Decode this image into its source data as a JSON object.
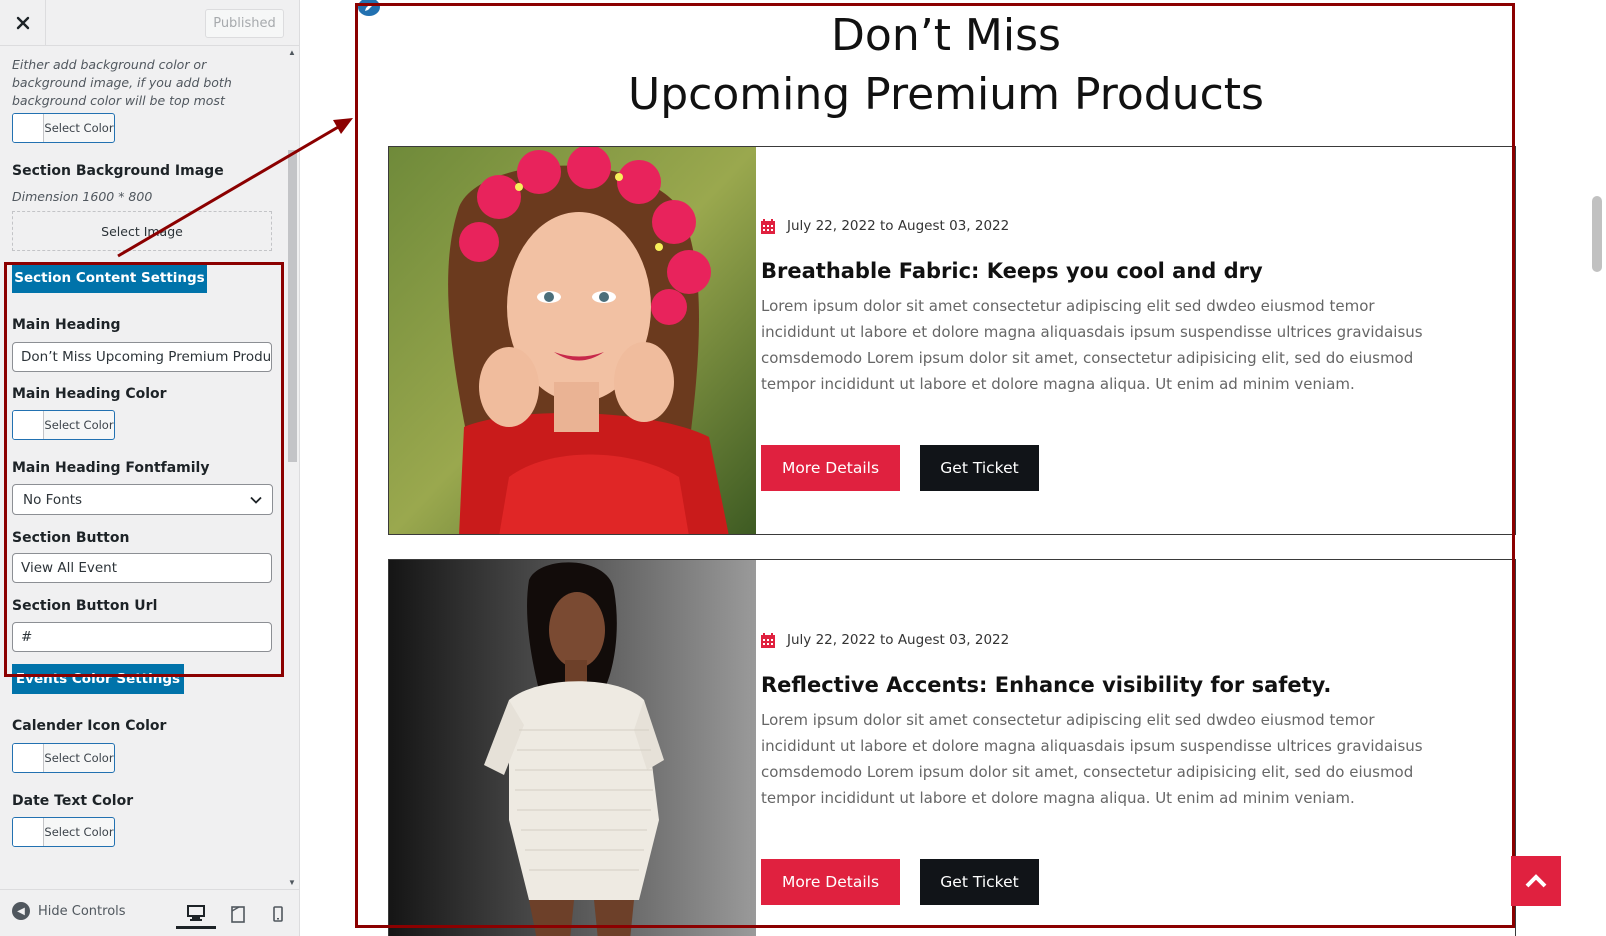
{
  "header": {
    "close_icon": "close-icon",
    "publish_label": "Published"
  },
  "sidebar": {
    "bg_help": "Either add background color or background image, if you add both background color will be top most priority",
    "color_button_label": "Select Color",
    "bg_image": {
      "label": "Section Background Image",
      "dimension": "Dimension 1600 * 800",
      "button": "Select Image"
    },
    "content_settings_button": "Section Content Settings",
    "main_heading": {
      "label": "Main Heading",
      "value": "Don’t Miss Upcoming Premium Products"
    },
    "main_heading_color_label": "Main Heading Color",
    "main_heading_font": {
      "label": "Main Heading Fontfamily",
      "selected": "No Fonts"
    },
    "section_button": {
      "label": "Section Button",
      "value": "View All Event"
    },
    "section_button_url": {
      "label": "Section Button Url",
      "value": "#"
    },
    "events_color_button": "Events Color Settings",
    "calendar_icon_color_label": "Calender Icon Color",
    "date_text_color_label": "Date Text Color"
  },
  "footer": {
    "hide_controls_label": "Hide Controls",
    "devices": [
      "desktop-icon",
      "tablet-icon",
      "mobile-icon"
    ]
  },
  "preview": {
    "heading_line1": "Don’t Miss",
    "heading_line2": "Upcoming Premium Products",
    "cards": [
      {
        "date": "July 22, 2022 to Augest 03, 2022",
        "title": "Breathable Fabric: Keeps you cool and dry",
        "description": "Lorem ipsum dolor sit amet consectetur adipiscing elit sed dwdeo eiusmod temor incididunt ut labore et dolore magna aliquasdais ipsum suspendisse ultrices gravidaisus comsdemodo Lorem ipsum dolor sit amet, consectetur adipisicing elit, sed do eiusmod tempor incididunt ut labore et dolore magna aliqua. Ut enim ad minim veniam.",
        "more_label": "More Details",
        "ticket_label": "Get Ticket"
      },
      {
        "date": "July 22, 2022 to Augest 03, 2022",
        "title": "Reflective Accents: Enhance visibility for safety.",
        "description": "Lorem ipsum dolor sit amet consectetur adipiscing elit sed dwdeo eiusmod temor incididunt ut labore et dolore magna aliquasdais ipsum suspendisse ultrices gravidaisus comsdemodo Lorem ipsum dolor sit amet, consectetur adipisicing elit, sed do eiusmod tempor incididunt ut labore et dolore magna aliqua. Ut enim ad minim veniam.",
        "more_label": "More Details",
        "ticket_label": "Get Ticket"
      }
    ]
  },
  "colors": {
    "accent_red": "#e0213f",
    "dark_button": "#111418",
    "wp_blue": "#0073aa",
    "annotation": "#8b0000"
  }
}
